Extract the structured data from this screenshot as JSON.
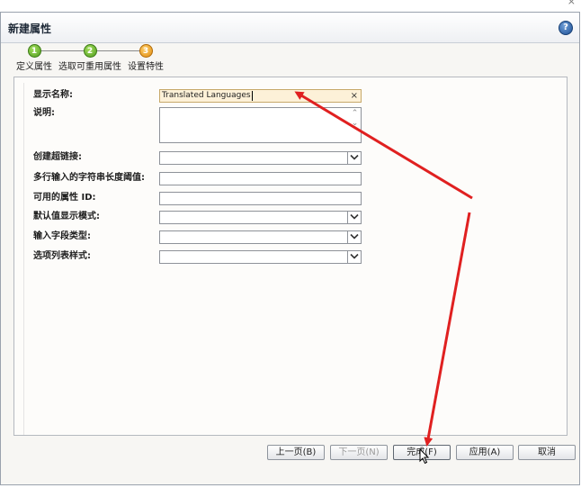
{
  "window": {
    "title": "新建属性",
    "help_glyph": "?",
    "help_icon": "help-icon",
    "close_glyph": "×"
  },
  "wizard": {
    "steps": [
      {
        "number": "1",
        "label": "定义属性",
        "state": "completed",
        "color": "#5aa82a"
      },
      {
        "number": "2",
        "label": "选取可重用属性",
        "state": "completed",
        "color": "#5aa82a"
      },
      {
        "number": "3",
        "label": "设置特性",
        "state": "current",
        "color": "#f0a020"
      }
    ]
  },
  "form": {
    "display_name": {
      "label": "显示名称:",
      "value": "Translated Languages",
      "clear_glyph": "×"
    },
    "description": {
      "label": "说明:",
      "value": ""
    },
    "create_hyperlink": {
      "label": "创建超链接:",
      "value": ""
    },
    "max_length": {
      "label": "多行输入的字符串长度阈值:",
      "value": ""
    },
    "attribute_id": {
      "label": "可用的属性 ID:",
      "value": ""
    },
    "default_display_mode": {
      "label": "默认值显示模式:",
      "value": ""
    },
    "input_field_type": {
      "label": "输入字段类型:",
      "value": ""
    },
    "option_list_style": {
      "label": "选项列表样式:",
      "value": ""
    }
  },
  "buttons": {
    "prev": "上一页(B)",
    "next": "下一页(N)",
    "finish": "完成(F)",
    "apply": "应用(A)",
    "cancel": "取消"
  },
  "colors": {
    "active_field": "#fdf1d8",
    "annotation_arrow": "#e02020",
    "help_blue": "#1d4f94"
  }
}
